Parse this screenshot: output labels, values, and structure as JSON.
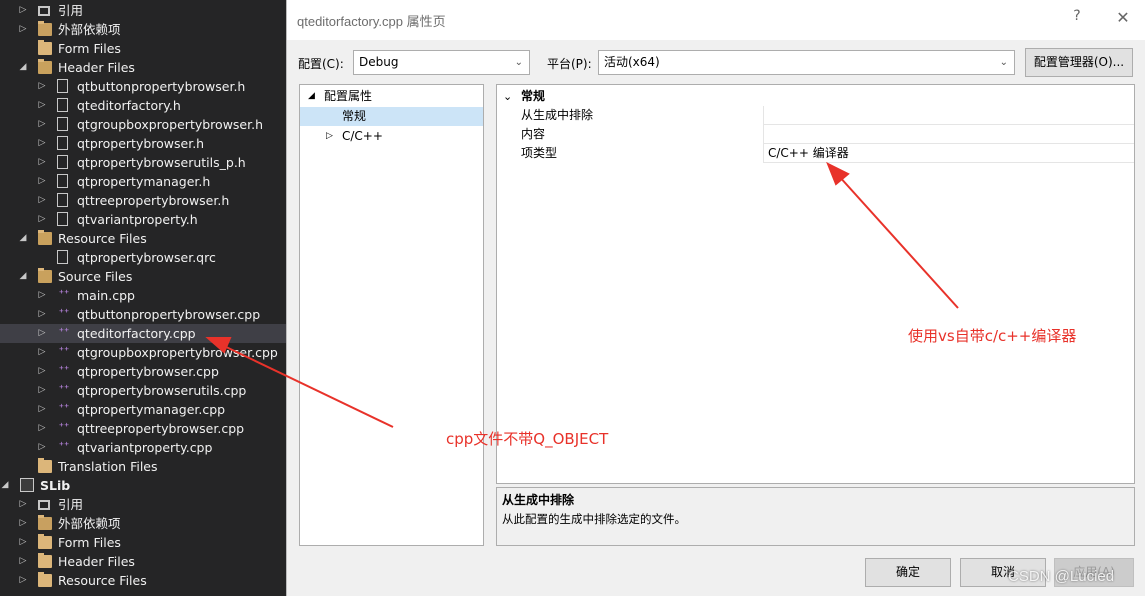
{
  "explorer": {
    "rows": [
      {
        "label": "引用",
        "indent": 0,
        "icon": "reference-icon",
        "arrow": "▷"
      },
      {
        "label": "外部依赖项",
        "indent": 0,
        "icon": "external-deps-icon",
        "arrow": "▷"
      },
      {
        "label": "Form Files",
        "indent": 0,
        "icon": "folder-icon",
        "arrow": ""
      },
      {
        "label": "Header Files",
        "indent": 0,
        "icon": "folder-open-icon",
        "arrow": "◢"
      },
      {
        "label": "qtbuttonpropertybrowser.h",
        "indent": 1,
        "icon": "header-file-icon",
        "arrow": "▷"
      },
      {
        "label": "qteditorfactory.h",
        "indent": 1,
        "icon": "header-file-icon",
        "arrow": "▷"
      },
      {
        "label": "qtgroupboxpropertybrowser.h",
        "indent": 1,
        "icon": "header-file-icon",
        "arrow": "▷"
      },
      {
        "label": "qtpropertybrowser.h",
        "indent": 1,
        "icon": "header-file-icon",
        "arrow": "▷"
      },
      {
        "label": "qtpropertybrowserutils_p.h",
        "indent": 1,
        "icon": "header-file-icon",
        "arrow": "▷"
      },
      {
        "label": "qtpropertymanager.h",
        "indent": 1,
        "icon": "header-file-icon",
        "arrow": "▷"
      },
      {
        "label": "qttreepropertybrowser.h",
        "indent": 1,
        "icon": "header-file-icon",
        "arrow": "▷"
      },
      {
        "label": "qtvariantproperty.h",
        "indent": 1,
        "icon": "header-file-icon",
        "arrow": "▷"
      },
      {
        "label": "Resource Files",
        "indent": 0,
        "icon": "folder-open-icon",
        "arrow": "◢"
      },
      {
        "label": "qtpropertybrowser.qrc",
        "indent": 1,
        "icon": "resource-file-icon",
        "arrow": ""
      },
      {
        "label": "Source Files",
        "indent": 0,
        "icon": "folder-open-icon",
        "arrow": "◢"
      },
      {
        "label": "main.cpp",
        "indent": 1,
        "icon": "cpp-file-icon",
        "arrow": "▷"
      },
      {
        "label": "qtbuttonpropertybrowser.cpp",
        "indent": 1,
        "icon": "cpp-file-icon",
        "arrow": "▷"
      },
      {
        "label": "qteditorfactory.cpp",
        "indent": 1,
        "icon": "cpp-file-icon",
        "arrow": "▷",
        "selected": true
      },
      {
        "label": "qtgroupboxpropertybrowser.cpp",
        "indent": 1,
        "icon": "cpp-file-icon",
        "arrow": "▷"
      },
      {
        "label": "qtpropertybrowser.cpp",
        "indent": 1,
        "icon": "cpp-file-icon",
        "arrow": "▷"
      },
      {
        "label": "qtpropertybrowserutils.cpp",
        "indent": 1,
        "icon": "cpp-file-icon",
        "arrow": "▷"
      },
      {
        "label": "qtpropertymanager.cpp",
        "indent": 1,
        "icon": "cpp-file-icon",
        "arrow": "▷"
      },
      {
        "label": "qttreepropertybrowser.cpp",
        "indent": 1,
        "icon": "cpp-file-icon",
        "arrow": "▷"
      },
      {
        "label": "qtvariantproperty.cpp",
        "indent": 1,
        "icon": "cpp-file-icon",
        "arrow": "▷"
      },
      {
        "label": "Translation Files",
        "indent": 0,
        "icon": "folder-icon",
        "arrow": ""
      },
      {
        "label": "SLib",
        "indent": -1,
        "icon": "project-icon",
        "arrow": "◢",
        "bold": true
      },
      {
        "label": "引用",
        "indent": 0,
        "icon": "reference-icon",
        "arrow": "▷"
      },
      {
        "label": "外部依赖项",
        "indent": 0,
        "icon": "external-deps-icon",
        "arrow": "▷"
      },
      {
        "label": "Form Files",
        "indent": 0,
        "icon": "folder-icon",
        "arrow": "▷"
      },
      {
        "label": "Header Files",
        "indent": 0,
        "icon": "folder-icon",
        "arrow": "▷"
      },
      {
        "label": "Resource Files",
        "indent": 0,
        "icon": "folder-icon",
        "arrow": "▷"
      }
    ]
  },
  "dialog": {
    "title": "qteditorfactory.cpp 属性页",
    "help": "?",
    "close": "✕",
    "config_label": "配置(C):",
    "config_value": "Debug",
    "platform_label": "平台(P):",
    "platform_value": "活动(x64)",
    "config_manager_button": "配置管理器(O)...",
    "left_tree": [
      {
        "label": "配置属性",
        "arrow": "◢",
        "indent": 0
      },
      {
        "label": "常规",
        "arrow": "",
        "indent": 1,
        "selected": true
      },
      {
        "label": "C/C++",
        "arrow": "▷",
        "indent": 1
      }
    ],
    "grid": {
      "category": "常规",
      "category_arrow": "⌄",
      "rows": [
        {
          "name": "从生成中排除",
          "value": ""
        },
        {
          "name": "内容",
          "value": ""
        },
        {
          "name": "项类型",
          "value": "C/C++ 编译器"
        }
      ]
    },
    "description": {
      "title": "从生成中排除",
      "text": "从此配置的生成中排除选定的文件。"
    },
    "ok_button": "确定",
    "cancel_button": "取消",
    "apply_button": "应用(A)"
  },
  "annotations": {
    "compiler_note": "使用vs自带c/c++编译器",
    "cpp_note": "cpp文件不带Q_OBJECT",
    "watermark": "CSDN @Lucied"
  },
  "colors": {
    "annotation": "#e8322a",
    "explorer_bg": "#252526",
    "selection": "#3f3f46"
  }
}
